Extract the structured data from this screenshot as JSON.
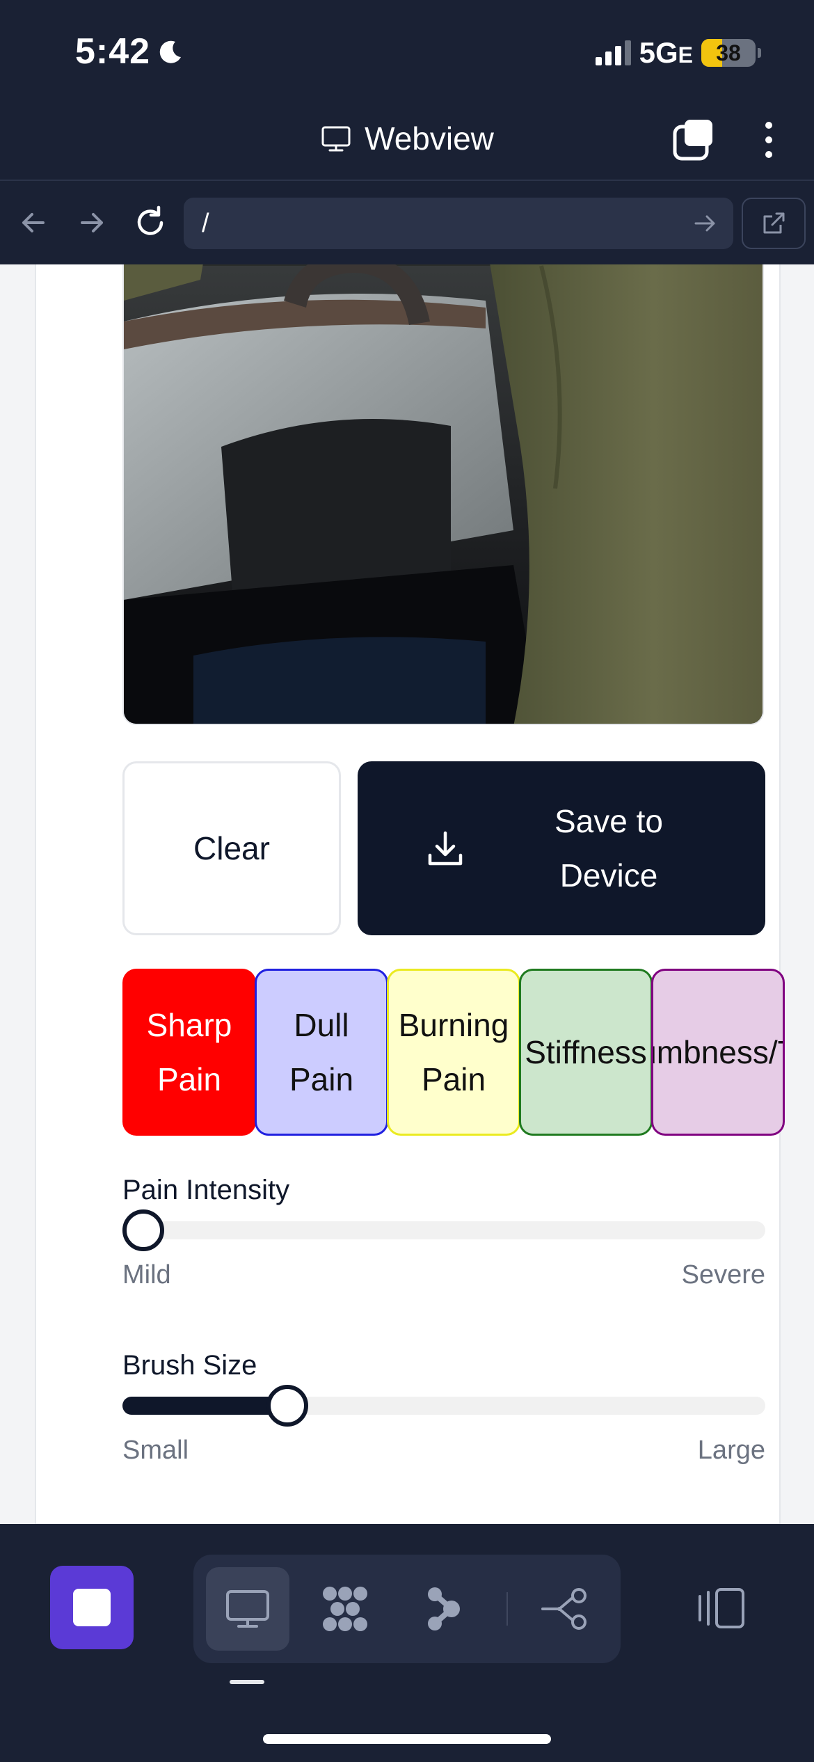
{
  "status_bar": {
    "time": "5:42",
    "network": "5G",
    "network_suffix": "E",
    "battery": "38",
    "battery_level": 0.38
  },
  "titlebar": {
    "title": "Webview"
  },
  "navbar": {
    "url": "/"
  },
  "actions": {
    "clear_label": "Clear",
    "save_label_line1": "Save to",
    "save_label_line2": "Device"
  },
  "pain_types": [
    {
      "line1": "Sharp",
      "line2": "Pain"
    },
    {
      "line1": "Dull",
      "line2": "Pain"
    },
    {
      "line1": "Burning",
      "line2": "Pain"
    },
    {
      "line1": "Stiffness"
    },
    {
      "line1": "Numbness/Tingling"
    }
  ],
  "colors": {
    "sharp": "#ff0000",
    "dull": "#ccccff",
    "burning": "#ffffcc",
    "stiffness": "#cce6cc",
    "numbness": "#e6cce6",
    "primary": "#0f172a",
    "accent": "#5b3ad6"
  },
  "sliders": {
    "intensity": {
      "label": "Pain Intensity",
      "min_label": "Mild",
      "max_label": "Severe",
      "value": 0.0
    },
    "brush": {
      "label": "Brush Size",
      "min_label": "Small",
      "max_label": "Large",
      "value": 0.24
    }
  },
  "icons": [
    "moon-icon",
    "monitor-icon",
    "tabs-icon",
    "more-icon",
    "back-icon",
    "forward-icon",
    "reload-icon",
    "go-icon",
    "external-link-icon",
    "download-icon",
    "grid-icon",
    "nodes-icon",
    "flow-icon",
    "panel-icon"
  ]
}
